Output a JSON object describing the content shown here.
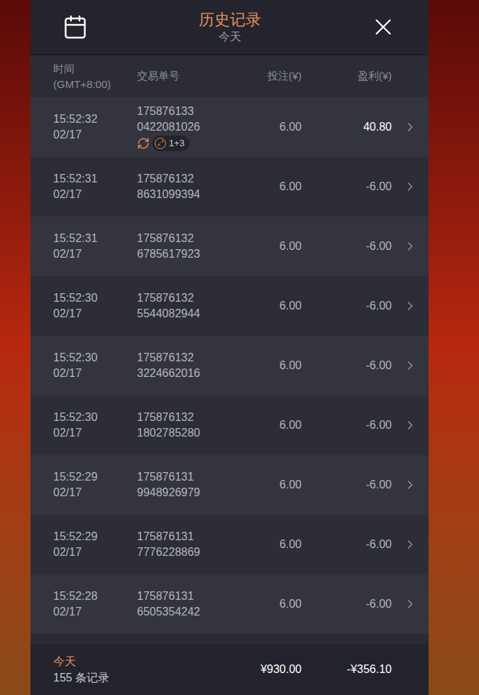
{
  "header": {
    "title": "历史记录",
    "subtitle": "今天"
  },
  "columns": {
    "time": "时间",
    "timezone": "(GMT+8:00)",
    "id": "交易单号",
    "bet": "投注(¥)",
    "profit": "盈利(¥)"
  },
  "rows": [
    {
      "time": "15:52:32",
      "date": "02/17",
      "id_line1": "175876133",
      "id_line2": "0422081026",
      "bet": "6.00",
      "profit": "40.80",
      "win": true,
      "badge": "1+3"
    },
    {
      "time": "15:52:31",
      "date": "02/17",
      "id_line1": "175876132",
      "id_line2": "8631099394",
      "bet": "6.00",
      "profit": "-6.00",
      "win": false,
      "badge": ""
    },
    {
      "time": "15:52:31",
      "date": "02/17",
      "id_line1": "175876132",
      "id_line2": "6785617923",
      "bet": "6.00",
      "profit": "-6.00",
      "win": false,
      "badge": ""
    },
    {
      "time": "15:52:30",
      "date": "02/17",
      "id_line1": "175876132",
      "id_line2": "5544082944",
      "bet": "6.00",
      "profit": "-6.00",
      "win": false,
      "badge": ""
    },
    {
      "time": "15:52:30",
      "date": "02/17",
      "id_line1": "175876132",
      "id_line2": "3224662016",
      "bet": "6.00",
      "profit": "-6.00",
      "win": false,
      "badge": ""
    },
    {
      "time": "15:52:30",
      "date": "02/17",
      "id_line1": "175876132",
      "id_line2": "1802785280",
      "bet": "6.00",
      "profit": "-6.00",
      "win": false,
      "badge": ""
    },
    {
      "time": "15:52:29",
      "date": "02/17",
      "id_line1": "175876131",
      "id_line2": "9948926979",
      "bet": "6.00",
      "profit": "-6.00",
      "win": false,
      "badge": ""
    },
    {
      "time": "15:52:29",
      "date": "02/17",
      "id_line1": "175876131",
      "id_line2": "7776228869",
      "bet": "6.00",
      "profit": "-6.00",
      "win": false,
      "badge": ""
    },
    {
      "time": "15:52:28",
      "date": "02/17",
      "id_line1": "175876131",
      "id_line2": "6505354242",
      "bet": "6.00",
      "profit": "-6.00",
      "win": false,
      "badge": ""
    }
  ],
  "footer": {
    "period": "今天",
    "count": "155 条记录",
    "total_bet": "¥930.00",
    "total_profit": "-¥356.10"
  }
}
